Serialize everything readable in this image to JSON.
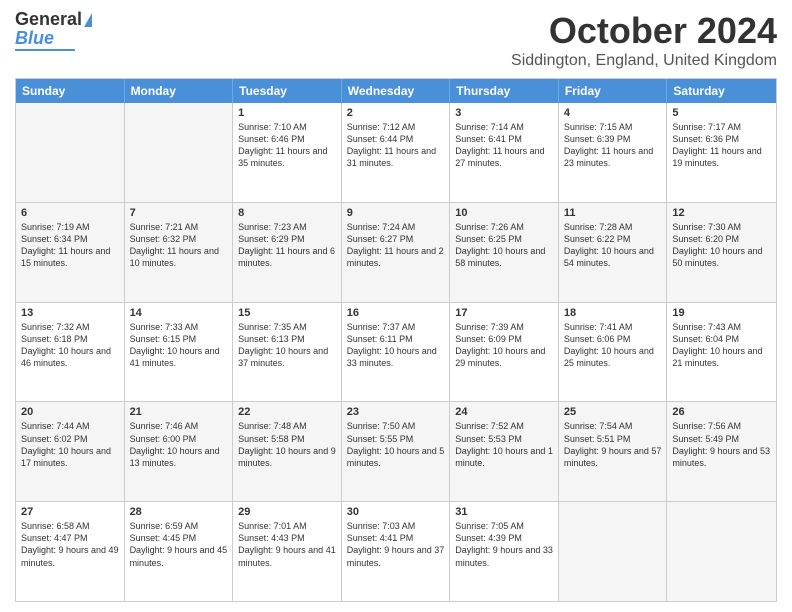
{
  "logo": {
    "line1": "General",
    "line2": "Blue"
  },
  "title": "October 2024",
  "subtitle": "Siddington, England, United Kingdom",
  "days": [
    "Sunday",
    "Monday",
    "Tuesday",
    "Wednesday",
    "Thursday",
    "Friday",
    "Saturday"
  ],
  "rows": [
    [
      {
        "day": "",
        "text": "",
        "empty": true
      },
      {
        "day": "",
        "text": "",
        "empty": true
      },
      {
        "day": "1",
        "text": "Sunrise: 7:10 AM\nSunset: 6:46 PM\nDaylight: 11 hours and 35 minutes."
      },
      {
        "day": "2",
        "text": "Sunrise: 7:12 AM\nSunset: 6:44 PM\nDaylight: 11 hours and 31 minutes."
      },
      {
        "day": "3",
        "text": "Sunrise: 7:14 AM\nSunset: 6:41 PM\nDaylight: 11 hours and 27 minutes."
      },
      {
        "day": "4",
        "text": "Sunrise: 7:15 AM\nSunset: 6:39 PM\nDaylight: 11 hours and 23 minutes."
      },
      {
        "day": "5",
        "text": "Sunrise: 7:17 AM\nSunset: 6:36 PM\nDaylight: 11 hours and 19 minutes."
      }
    ],
    [
      {
        "day": "6",
        "text": "Sunrise: 7:19 AM\nSunset: 6:34 PM\nDaylight: 11 hours and 15 minutes."
      },
      {
        "day": "7",
        "text": "Sunrise: 7:21 AM\nSunset: 6:32 PM\nDaylight: 11 hours and 10 minutes."
      },
      {
        "day": "8",
        "text": "Sunrise: 7:23 AM\nSunset: 6:29 PM\nDaylight: 11 hours and 6 minutes."
      },
      {
        "day": "9",
        "text": "Sunrise: 7:24 AM\nSunset: 6:27 PM\nDaylight: 11 hours and 2 minutes."
      },
      {
        "day": "10",
        "text": "Sunrise: 7:26 AM\nSunset: 6:25 PM\nDaylight: 10 hours and 58 minutes."
      },
      {
        "day": "11",
        "text": "Sunrise: 7:28 AM\nSunset: 6:22 PM\nDaylight: 10 hours and 54 minutes."
      },
      {
        "day": "12",
        "text": "Sunrise: 7:30 AM\nSunset: 6:20 PM\nDaylight: 10 hours and 50 minutes."
      }
    ],
    [
      {
        "day": "13",
        "text": "Sunrise: 7:32 AM\nSunset: 6:18 PM\nDaylight: 10 hours and 46 minutes."
      },
      {
        "day": "14",
        "text": "Sunrise: 7:33 AM\nSunset: 6:15 PM\nDaylight: 10 hours and 41 minutes."
      },
      {
        "day": "15",
        "text": "Sunrise: 7:35 AM\nSunset: 6:13 PM\nDaylight: 10 hours and 37 minutes."
      },
      {
        "day": "16",
        "text": "Sunrise: 7:37 AM\nSunset: 6:11 PM\nDaylight: 10 hours and 33 minutes."
      },
      {
        "day": "17",
        "text": "Sunrise: 7:39 AM\nSunset: 6:09 PM\nDaylight: 10 hours and 29 minutes."
      },
      {
        "day": "18",
        "text": "Sunrise: 7:41 AM\nSunset: 6:06 PM\nDaylight: 10 hours and 25 minutes."
      },
      {
        "day": "19",
        "text": "Sunrise: 7:43 AM\nSunset: 6:04 PM\nDaylight: 10 hours and 21 minutes."
      }
    ],
    [
      {
        "day": "20",
        "text": "Sunrise: 7:44 AM\nSunset: 6:02 PM\nDaylight: 10 hours and 17 minutes."
      },
      {
        "day": "21",
        "text": "Sunrise: 7:46 AM\nSunset: 6:00 PM\nDaylight: 10 hours and 13 minutes."
      },
      {
        "day": "22",
        "text": "Sunrise: 7:48 AM\nSunset: 5:58 PM\nDaylight: 10 hours and 9 minutes."
      },
      {
        "day": "23",
        "text": "Sunrise: 7:50 AM\nSunset: 5:55 PM\nDaylight: 10 hours and 5 minutes."
      },
      {
        "day": "24",
        "text": "Sunrise: 7:52 AM\nSunset: 5:53 PM\nDaylight: 10 hours and 1 minute."
      },
      {
        "day": "25",
        "text": "Sunrise: 7:54 AM\nSunset: 5:51 PM\nDaylight: 9 hours and 57 minutes."
      },
      {
        "day": "26",
        "text": "Sunrise: 7:56 AM\nSunset: 5:49 PM\nDaylight: 9 hours and 53 minutes."
      }
    ],
    [
      {
        "day": "27",
        "text": "Sunrise: 6:58 AM\nSunset: 4:47 PM\nDaylight: 9 hours and 49 minutes."
      },
      {
        "day": "28",
        "text": "Sunrise: 6:59 AM\nSunset: 4:45 PM\nDaylight: 9 hours and 45 minutes."
      },
      {
        "day": "29",
        "text": "Sunrise: 7:01 AM\nSunset: 4:43 PM\nDaylight: 9 hours and 41 minutes."
      },
      {
        "day": "30",
        "text": "Sunrise: 7:03 AM\nSunset: 4:41 PM\nDaylight: 9 hours and 37 minutes."
      },
      {
        "day": "31",
        "text": "Sunrise: 7:05 AM\nSunset: 4:39 PM\nDaylight: 9 hours and 33 minutes."
      },
      {
        "day": "",
        "text": "",
        "empty": true
      },
      {
        "day": "",
        "text": "",
        "empty": true
      }
    ]
  ]
}
